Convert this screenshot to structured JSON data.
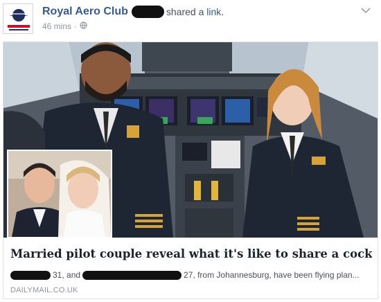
{
  "post": {
    "author": "Royal Aero Club",
    "action": "shared a ",
    "action_link": "link.",
    "time": "46 mins",
    "separator": "·"
  },
  "card": {
    "headline": "Married pilot couple reveal what it's like to share a cock...",
    "desc_part1": "31, and",
    "desc_part2": "27, from Johannesburg, have been flying plan...",
    "source": "DAILYMAIL.CO.UK"
  },
  "colors": {
    "link_blue": "#365899",
    "meta_grey": "#90949c"
  },
  "icons": [
    "royal-aero-club-logo",
    "globe-icon",
    "chevron-down-icon"
  ]
}
